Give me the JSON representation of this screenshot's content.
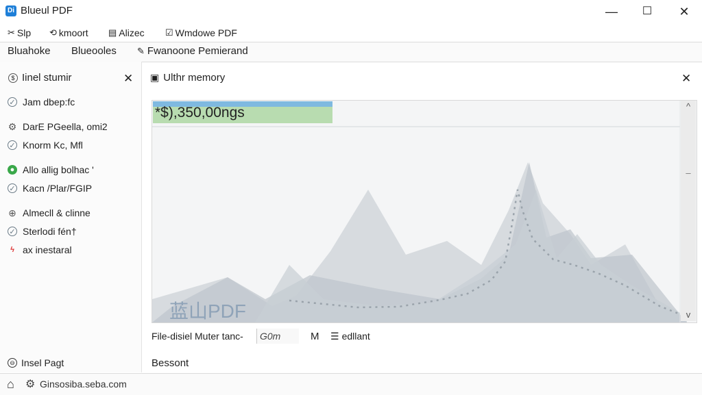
{
  "window": {
    "title": "Blueul PDF",
    "app_icon": "Di",
    "minimize": "—",
    "maximize": "☐",
    "close": "✕"
  },
  "menu": [
    {
      "label": "Slp",
      "icon": "scissors-icon"
    },
    {
      "label": "kmoort",
      "icon": "import-icon"
    },
    {
      "label": "Alizec",
      "icon": "document-icon"
    },
    {
      "label": "Wmdowe PDF",
      "icon": "window-check-icon"
    }
  ],
  "tabs": [
    {
      "label": "Bluahoke"
    },
    {
      "label": "Blueooles"
    },
    {
      "label": "Fwanoone Pemierand",
      "icon": "edit-icon"
    }
  ],
  "sidebar": {
    "title": "Iinel stumir",
    "close": "✕",
    "items": [
      {
        "label": "Jam dbep:fc",
        "icon": "check-circle-icon"
      },
      {
        "label": "DarE PGeella, omi2",
        "icon": "gear-icon"
      },
      {
        "label": "Knorm Kc, Mfl",
        "icon": "check-circle-icon"
      },
      {
        "label": "Allo allig bolhac '",
        "icon": "green-dot-icon"
      },
      {
        "label": "Kacn /Plar/FGIP",
        "icon": "check-circle-icon"
      },
      {
        "label": "Almecll & clinne",
        "icon": "globe-icon"
      },
      {
        "label": "Sterlodi fén†",
        "icon": "check-circle-icon"
      },
      {
        "label": "ax inestaral",
        "icon": "flash-icon"
      }
    ],
    "footer": "Insel Pagt"
  },
  "panel": {
    "title": "Ulthr memory",
    "close": "✕",
    "progress_text": "*$),350,00ngs",
    "progress_fraction": 0.33,
    "watermark": "蓝山PDF",
    "scroll_up": "^",
    "scroll_down": "v",
    "scroll_mid": "–"
  },
  "status": {
    "label": "File-disiel Muter tanc-",
    "input_value": "G0m",
    "m_label": "M",
    "edit_label": "edllant"
  },
  "bottom_label": "Bessont",
  "footer": {
    "url": "Ginsosiba.seba.com"
  },
  "colors": {
    "accent": "#1e7fd8",
    "progress_green": "#b8dcb0",
    "progress_blue": "#7fb9e0",
    "chart_fill": "#c6ccd2"
  }
}
